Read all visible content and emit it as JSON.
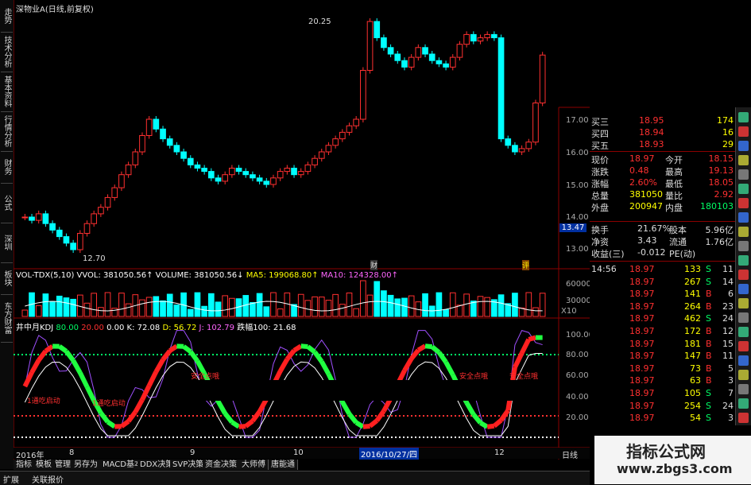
{
  "title": "深物业A(日线,前复权)",
  "sidebar": [
    "走势",
    "技术分析",
    "基本资料",
    "行情分析",
    "财务",
    "公式",
    "深圳",
    "板块",
    "东方财富"
  ],
  "price_chart": {
    "high_label": "20.25",
    "low_label": "12.70",
    "y_ticks": [
      "17.00",
      "16.00",
      "15.00",
      "14.00",
      "13.00"
    ],
    "current_marker": "13.47",
    "fin_tag1": "财",
    "fin_tag2": "评"
  },
  "volume_panel": {
    "header_a": "VOL-TDX(5,10) VVOL: 381050.56↑",
    "header_b": "VOLUME: 381050.56↓",
    "header_c": "MA5: 199068.80↑",
    "header_d": "MA10: 124328.00↑",
    "y_ticks": [
      "60000",
      "30000",
      "X10"
    ]
  },
  "kdj_panel": {
    "header_a": "井中月KDJ",
    "header_b": "80.00",
    "header_c": "20.00",
    "header_d": "0.00",
    "header_e": "K: 72.08",
    "header_f": "D: 56.72",
    "header_g": "J: 102.79",
    "header_h": "跌幅100: 21.68",
    "label1": "1通吃启动",
    "label2": "1通吃启动",
    "label3": "安全点哦",
    "label4": "安全点哦",
    "label5": "安全点哦",
    "y_ticks": [
      "100.00",
      "80.00",
      "60.00",
      "40.00",
      "20.00"
    ]
  },
  "date_bar": {
    "year": "2016年",
    "m8": "8",
    "m9": "9",
    "m10": "10",
    "date": "2016/10/27/四",
    "m12": "12",
    "period": "日线"
  },
  "buttons": [
    "指标",
    "模板",
    "管理",
    "另存为",
    "MACD基本",
    "DDX决策",
    "SVP决策",
    "资金决策",
    "大师傅",
    "唐能通"
  ],
  "bottom_tabs": [
    "扩展",
    "关联报价"
  ],
  "order_book": [
    {
      "label": "买三",
      "price": "18.95",
      "vol": "174"
    },
    {
      "label": "买四",
      "price": "18.94",
      "vol": "16"
    },
    {
      "label": "买五",
      "price": "18.93",
      "vol": "29"
    }
  ],
  "quote": [
    {
      "l1": "现价",
      "v1": "18.97",
      "l2": "今开",
      "v2": "18.15"
    },
    {
      "l1": "涨跌",
      "v1": "0.48",
      "l2": "最高",
      "v2": "19.13"
    },
    {
      "l1": "涨幅",
      "v1": "2.60%",
      "l2": "最低",
      "v2": "18.05"
    },
    {
      "l1": "总量",
      "v1": "381050",
      "l2": "量比",
      "v2": "2.92"
    },
    {
      "l1": "外盘",
      "v1": "200947",
      "l2": "内盘",
      "v2": "180103"
    }
  ],
  "quote2": [
    {
      "l1": "换手",
      "v1": "21.67%",
      "l2": "股本",
      "v2": "5.96亿"
    },
    {
      "l1": "净资",
      "v1": "3.43",
      "l2": "流通",
      "v2": "1.76亿"
    },
    {
      "l1": "收益(三)",
      "v1": "-0.012",
      "l2": "PE(动)",
      "v2": ""
    }
  ],
  "ticks": [
    {
      "t": "14:56",
      "p": "18.97",
      "v": "133",
      "s": "S",
      "n": "11"
    },
    {
      "t": "",
      "p": "18.97",
      "v": "267",
      "s": "S",
      "n": "14"
    },
    {
      "t": "",
      "p": "18.97",
      "v": "141",
      "s": "B",
      "n": "6"
    },
    {
      "t": "",
      "p": "18.97",
      "v": "264",
      "s": "B",
      "n": "23"
    },
    {
      "t": "",
      "p": "18.97",
      "v": "462",
      "s": "S",
      "n": "24"
    },
    {
      "t": "",
      "p": "18.97",
      "v": "172",
      "s": "B",
      "n": "12"
    },
    {
      "t": "",
      "p": "18.97",
      "v": "181",
      "s": "B",
      "n": "15"
    },
    {
      "t": "",
      "p": "18.97",
      "v": "147",
      "s": "B",
      "n": "11"
    },
    {
      "t": "",
      "p": "18.97",
      "v": "73",
      "s": "B",
      "n": "5"
    },
    {
      "t": "",
      "p": "18.97",
      "v": "63",
      "s": "B",
      "n": "3"
    },
    {
      "t": "",
      "p": "18.97",
      "v": "105",
      "s": "S",
      "n": "7"
    },
    {
      "t": "",
      "p": "18.97",
      "v": "254",
      "s": "S",
      "n": "24"
    },
    {
      "t": "",
      "p": "18.97",
      "v": "54",
      "s": "S",
      "n": "3"
    }
  ],
  "watermark": {
    "line1": "指标公式网",
    "line2": "www.zbgs3.com"
  }
}
